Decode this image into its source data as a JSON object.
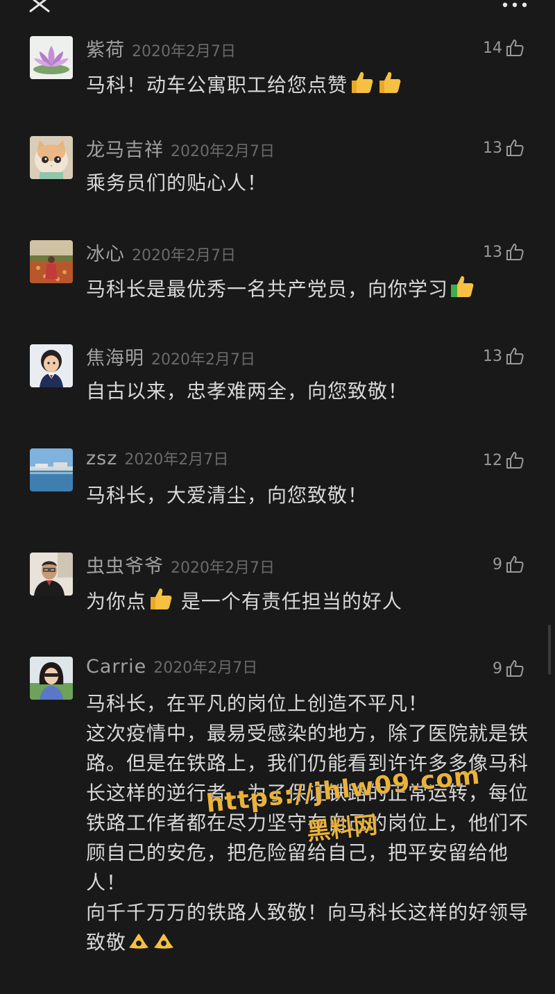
{
  "comments": [
    {
      "name": "紫荷",
      "date": "2020年2月7日",
      "likes": "14",
      "text_parts": [
        "马科！动车公寓职工给您点赞",
        "",
        ""
      ],
      "avatar": "lotus"
    },
    {
      "name": "龙马吉祥",
      "date": "2020年2月7日",
      "likes": "13",
      "text_parts": [
        "乘务员们的贴心人！",
        "",
        ""
      ],
      "avatar": "kitten"
    },
    {
      "name": "冰心",
      "date": "2020年2月7日",
      "likes": "13",
      "text_parts": [
        "马科长是最优秀一名共产党员，向你学习",
        "",
        ""
      ],
      "avatar": "field"
    },
    {
      "name": "焦海明",
      "date": "2020年2月7日",
      "likes": "13",
      "text_parts": [
        "自古以来，忠孝难两全，向您致敬！",
        "",
        ""
      ],
      "avatar": "child"
    },
    {
      "name": "zsz",
      "date": "2020年2月7日",
      "likes": "12",
      "text_parts": [
        "马科长，大爱清尘，向您致敬！",
        "",
        ""
      ],
      "avatar": "lake"
    },
    {
      "name": "虫虫爷爷",
      "date": "2020年2月7日",
      "likes": "9",
      "text_parts": [
        "为你点",
        " 是一个有责任担当的好人",
        ""
      ],
      "avatar": "man"
    },
    {
      "name": "Carrie",
      "date": "2020年2月7日",
      "likes": "9",
      "text_parts": [
        "马科长，在平凡的岗位上创造不平凡！\n这次疫情中，最易受感染的地方，除了医院就是铁路。但是在铁路上，我们仍能看到许许多多像马科长这样的逆行者，为了保证铁路的正常运转，每位铁路工作者都在尽力坚守在自己的岗位上，他们不顾自己的安危，把危险留给自己，把平安留给他人！\n向千千万万的铁路人致敬！向马科长这样的好领导致敬",
        "",
        ""
      ],
      "avatar": "woman"
    }
  ],
  "watermark": {
    "url": "https://jhlw09.com",
    "name": "黑料网"
  },
  "icons": {
    "close": "close-icon",
    "more": "more-icon",
    "like": "thumbs-up-outline-icon",
    "emoji_thumb": "thumbs-up-emoji",
    "emoji_ok": "ok-hand-emoji"
  }
}
